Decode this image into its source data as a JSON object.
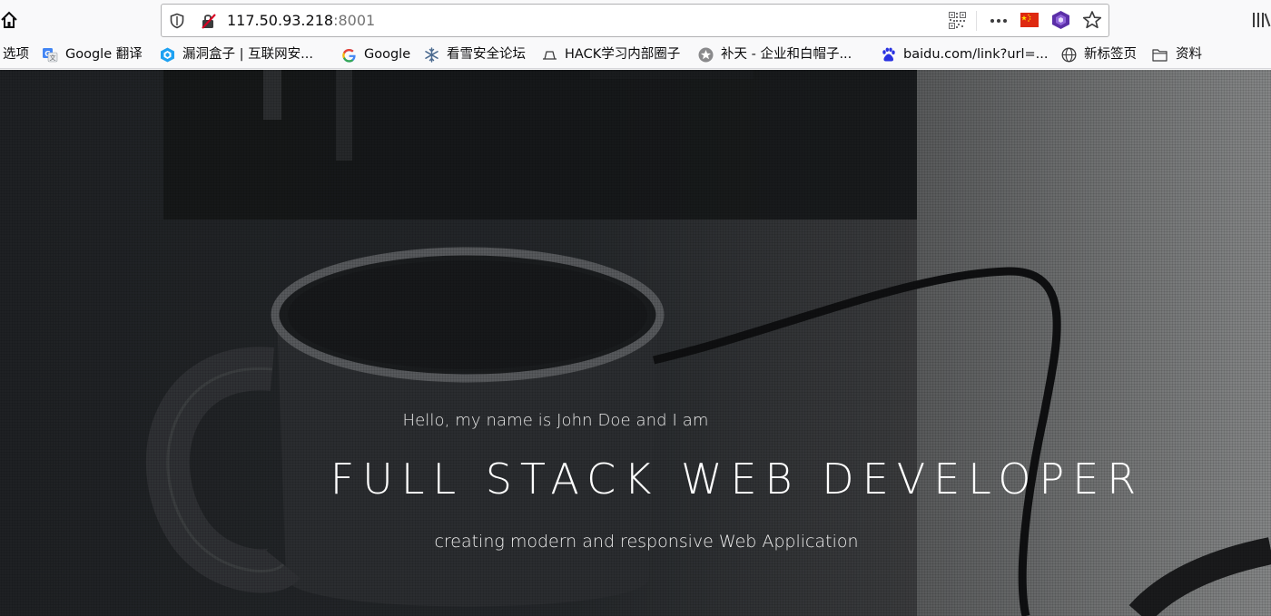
{
  "browser": {
    "url_host": "117.50.93.218",
    "url_port": ":8001",
    "icons": {
      "home": "home-icon",
      "shield": "tracking-protection-icon",
      "insecure": "insecure-connection-icon",
      "qr": "qr-code-icon",
      "menu": "more-icon",
      "flag": "china-flag-icon",
      "extension": "extension-icon",
      "bookmark": "bookmark-star-icon",
      "library": "library-icon"
    }
  },
  "bookmarks": [
    {
      "label": "选项",
      "icon": "none"
    },
    {
      "label": "Google 翻译",
      "icon": "google-translate-icon"
    },
    {
      "label": "漏洞盒子 | 互联网安...",
      "icon": "hexagon-shield-icon"
    },
    {
      "label": "Google",
      "icon": "google-icon"
    },
    {
      "label": "看雪安全论坛",
      "icon": "snowflake-icon"
    },
    {
      "label": "HACK学习内部圈子",
      "icon": "hat-icon"
    },
    {
      "label": "补天 - 企业和白帽子...",
      "icon": "star-badge-icon"
    },
    {
      "label": "baidu.com/link?url=...",
      "icon": "baidu-paw-icon"
    },
    {
      "label": "新标签页",
      "icon": "globe-icon"
    },
    {
      "label": "资料",
      "icon": "folder-icon"
    }
  ],
  "hero": {
    "greeting": "Hello, my name is John Doe and I am",
    "title": "FULL STACK WEB DEVELOPER",
    "tagline": "creating modern and responsive Web Application"
  },
  "colors": {
    "background_dark": "#1f2124",
    "background_light": "#8a8b8c",
    "hero_text": "#ffffff"
  }
}
